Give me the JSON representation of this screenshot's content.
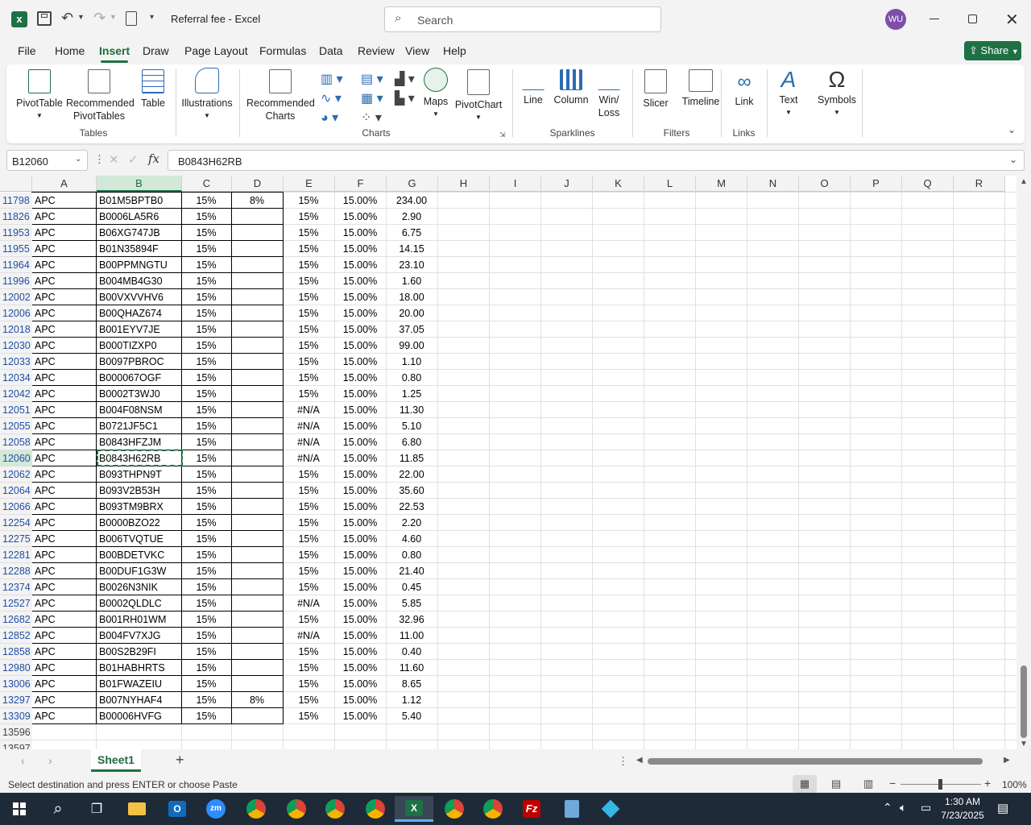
{
  "title": {
    "doc": "Referral fee",
    "sep": "-",
    "app": "Excel",
    "search": "Search",
    "avatar": "WU"
  },
  "menu": [
    "File",
    "Home",
    "Insert",
    "Draw",
    "Page Layout",
    "Formulas",
    "Data",
    "Review",
    "View",
    "Help"
  ],
  "share": "Share",
  "ribbon": {
    "pivottable": "PivotTable",
    "recommended": "Recommended",
    "pivottables": "PivotTables",
    "table": "Table",
    "illustrations": "Illustrations",
    "recommended2": "Recommended",
    "charts": "Charts",
    "maps": "Maps",
    "pivotchart": "PivotChart",
    "line": "Line",
    "column": "Column",
    "win": "Win/",
    "loss": "Loss",
    "slicer": "Slicer",
    "timeline": "Timeline",
    "link": "Link",
    "text": "Text",
    "symbols": "Symbols",
    "groups": {
      "tables": "Tables",
      "charts": "Charts",
      "sparklines": "Sparklines",
      "filters": "Filters",
      "links": "Links"
    }
  },
  "namebox": "B12060",
  "formula": "B0843H62RB",
  "columns": [
    "A",
    "B",
    "C",
    "D",
    "E",
    "F",
    "G",
    "H",
    "I",
    "J",
    "K",
    "L",
    "M",
    "N",
    "O",
    "P",
    "Q",
    "R"
  ],
  "rows": [
    [
      "11798",
      "APC",
      "B01M5BPTB0",
      "15%",
      "8%",
      "15%",
      "15.00%",
      "234.00"
    ],
    [
      "11826",
      "APC",
      "B0006LA5R6",
      "15%",
      "",
      "15%",
      "15.00%",
      "2.90"
    ],
    [
      "11953",
      "APC",
      "B06XG747JB",
      "15%",
      "",
      "15%",
      "15.00%",
      "6.75"
    ],
    [
      "11955",
      "APC",
      "B01N35894F",
      "15%",
      "",
      "15%",
      "15.00%",
      "14.15"
    ],
    [
      "11964",
      "APC",
      "B00PPMNGTU",
      "15%",
      "",
      "15%",
      "15.00%",
      "23.10"
    ],
    [
      "11996",
      "APC",
      "B004MB4G30",
      "15%",
      "",
      "15%",
      "15.00%",
      "1.60"
    ],
    [
      "12002",
      "APC",
      "B00VXVVHV6",
      "15%",
      "",
      "15%",
      "15.00%",
      "18.00"
    ],
    [
      "12006",
      "APC",
      "B00QHAZ674",
      "15%",
      "",
      "15%",
      "15.00%",
      "20.00"
    ],
    [
      "12018",
      "APC",
      "B001EYV7JE",
      "15%",
      "",
      "15%",
      "15.00%",
      "37.05"
    ],
    [
      "12030",
      "APC",
      "B000TIZXP0",
      "15%",
      "",
      "15%",
      "15.00%",
      "99.00"
    ],
    [
      "12033",
      "APC",
      "B0097PBROC",
      "15%",
      "",
      "15%",
      "15.00%",
      "1.10"
    ],
    [
      "12034",
      "APC",
      "B000067OGF",
      "15%",
      "",
      "15%",
      "15.00%",
      "0.80"
    ],
    [
      "12042",
      "APC",
      "B0002T3WJ0",
      "15%",
      "",
      "15%",
      "15.00%",
      "1.25"
    ],
    [
      "12051",
      "APC",
      "B004F08NSM",
      "15%",
      "",
      "#N/A",
      "15.00%",
      "11.30"
    ],
    [
      "12055",
      "APC",
      "B0721JF5C1",
      "15%",
      "",
      "#N/A",
      "15.00%",
      "5.10"
    ],
    [
      "12058",
      "APC",
      "B0843HFZJM",
      "15%",
      "",
      "#N/A",
      "15.00%",
      "6.80"
    ],
    [
      "12060",
      "APC",
      "B0843H62RB",
      "15%",
      "",
      "#N/A",
      "15.00%",
      "11.85"
    ],
    [
      "12062",
      "APC",
      "B093THPN9T",
      "15%",
      "",
      "15%",
      "15.00%",
      "22.00"
    ],
    [
      "12064",
      "APC",
      "B093V2B53H",
      "15%",
      "",
      "15%",
      "15.00%",
      "35.60"
    ],
    [
      "12066",
      "APC",
      "B093TM9BRX",
      "15%",
      "",
      "15%",
      "15.00%",
      "22.53"
    ],
    [
      "12254",
      "APC",
      "B0000BZO22",
      "15%",
      "",
      "15%",
      "15.00%",
      "2.20"
    ],
    [
      "12275",
      "APC",
      "B006TVQTUE",
      "15%",
      "",
      "15%",
      "15.00%",
      "4.60"
    ],
    [
      "12281",
      "APC",
      "B00BDETVKC",
      "15%",
      "",
      "15%",
      "15.00%",
      "0.80"
    ],
    [
      "12288",
      "APC",
      "B00DUF1G3W",
      "15%",
      "",
      "15%",
      "15.00%",
      "21.40"
    ],
    [
      "12374",
      "APC",
      "B0026N3NIK",
      "15%",
      "",
      "15%",
      "15.00%",
      "0.45"
    ],
    [
      "12527",
      "APC",
      "B0002QLDLC",
      "15%",
      "",
      "#N/A",
      "15.00%",
      "5.85"
    ],
    [
      "12682",
      "APC",
      "B001RH01WM",
      "15%",
      "",
      "15%",
      "15.00%",
      "32.96"
    ],
    [
      "12852",
      "APC",
      "B004FV7XJG",
      "15%",
      "",
      "#N/A",
      "15.00%",
      "11.00"
    ],
    [
      "12858",
      "APC",
      "B00S2B29FI",
      "15%",
      "",
      "15%",
      "15.00%",
      "0.40"
    ],
    [
      "12980",
      "APC",
      "B01HABHRTS",
      "15%",
      "",
      "15%",
      "15.00%",
      "11.60"
    ],
    [
      "13006",
      "APC",
      "B01FWAZEIU",
      "15%",
      "",
      "15%",
      "15.00%",
      "8.65"
    ],
    [
      "13297",
      "APC",
      "B007NYHAF4",
      "15%",
      "8%",
      "15%",
      "15.00%",
      "1.12"
    ],
    [
      "13309",
      "APC",
      "B00006HVFG",
      "15%",
      "",
      "15%",
      "15.00%",
      "5.40"
    ],
    [
      "13596",
      "",
      "",
      "",
      "",
      "",
      "",
      ""
    ],
    [
      "13597",
      "",
      "",
      "",
      "",
      "",
      "",
      ""
    ]
  ],
  "sheet": "Sheet1",
  "status": "Select destination and press ENTER or choose Paste",
  "zoom": "100%",
  "clock": {
    "time": "1:30 AM",
    "date": "7/23/2025"
  },
  "colors": {
    "excel_green": "#1e7145",
    "selected_header": "#d3e8d8",
    "taskbar": "#1f2a38"
  }
}
